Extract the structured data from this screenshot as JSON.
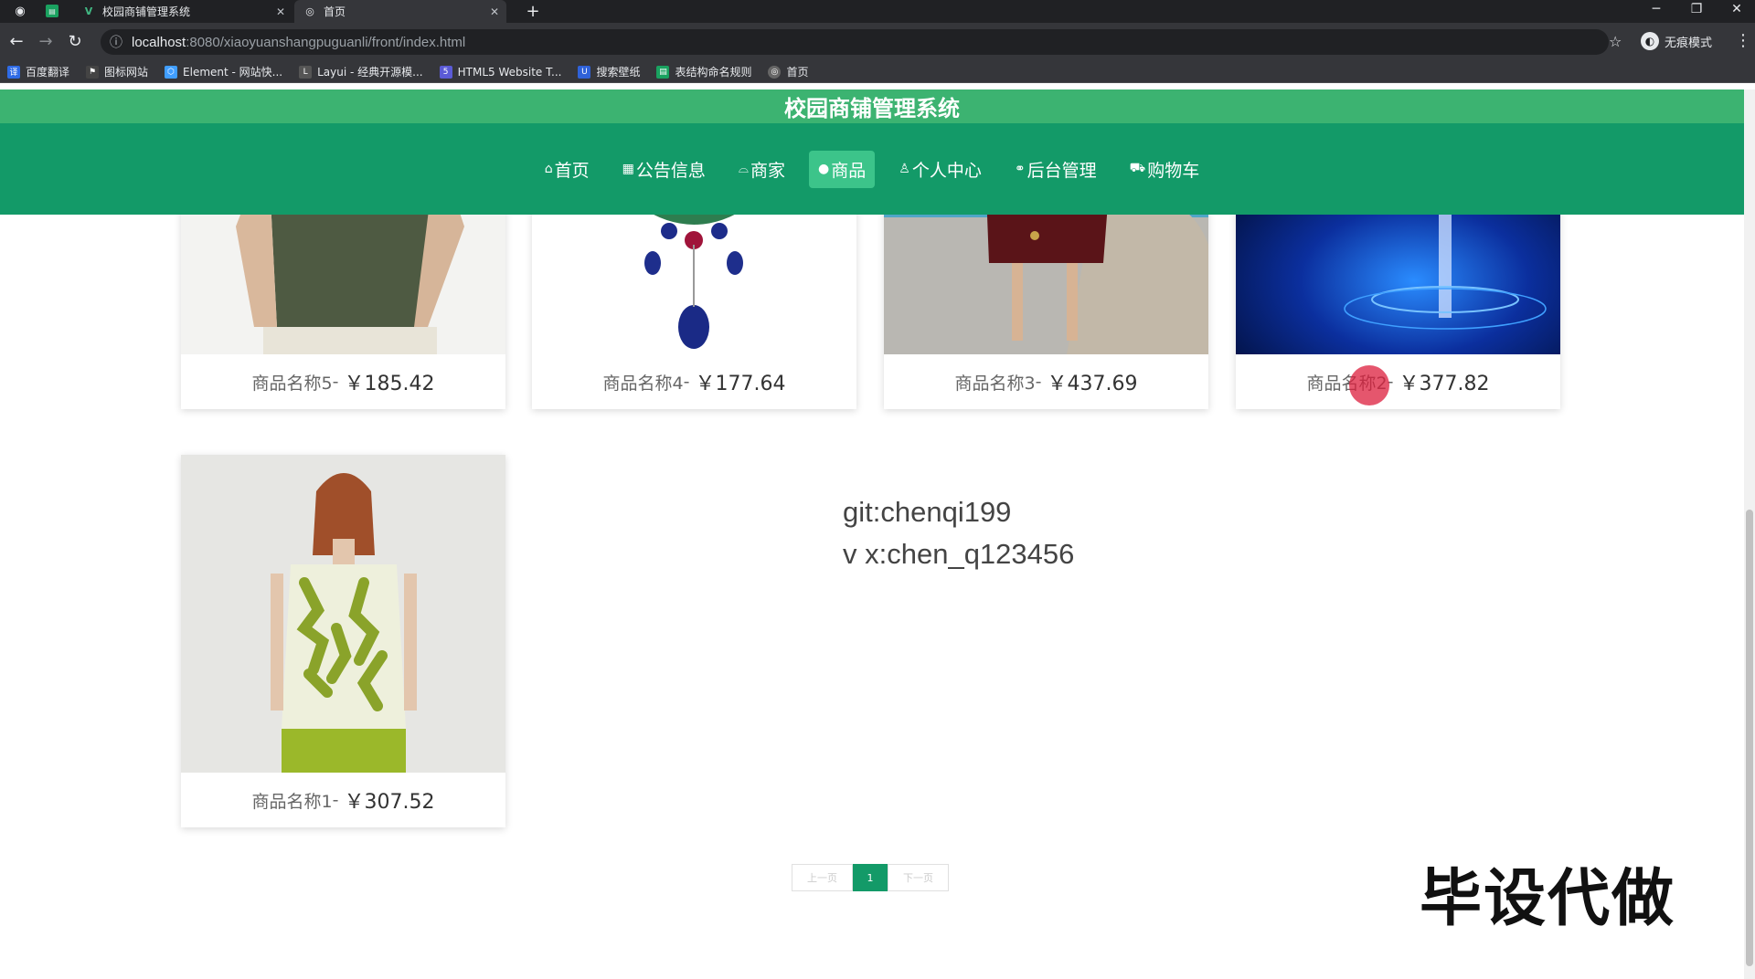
{
  "browser": {
    "tabs": [
      {
        "label": "校园商铺管理系统",
        "active": false
      },
      {
        "label": "首页",
        "active": true
      }
    ],
    "url_host": "localhost",
    "url_path": ":8080/xiaoyuanshangpuguanli/front/index.html",
    "incognito_label": "无痕模式",
    "bookmarks": [
      {
        "label": "百度翻译",
        "icon": "translate-icon",
        "color": "#2e6be6"
      },
      {
        "label": "图标网站",
        "icon": "flag-icon",
        "color": "#444"
      },
      {
        "label": "Element - 网站快...",
        "icon": "element-icon",
        "color": "#409eff"
      },
      {
        "label": "Layui - 经典开源模...",
        "icon": "layui-icon",
        "color": "#555"
      },
      {
        "label": "HTML5 Website T...",
        "icon": "html5-icon",
        "color": "#5b5bd6"
      },
      {
        "label": "搜索壁纸",
        "icon": "wallpaper-icon",
        "color": "#2f62d9"
      },
      {
        "label": "表结构命名规则",
        "icon": "doc-icon",
        "color": "#1aa260"
      },
      {
        "label": "首页",
        "icon": "globe-icon",
        "color": "#666"
      }
    ]
  },
  "site": {
    "title": "校园商铺管理系统",
    "nav": [
      {
        "label": "首页",
        "icon": "home-icon",
        "active": false
      },
      {
        "label": "公告信息",
        "icon": "grid-icon",
        "active": false
      },
      {
        "label": "商家",
        "icon": "shop-icon",
        "active": false
      },
      {
        "label": "商品",
        "icon": "goods-icon",
        "active": true
      },
      {
        "label": "个人中心",
        "icon": "user-icon",
        "active": false
      },
      {
        "label": "后台管理",
        "icon": "link-icon",
        "active": false
      },
      {
        "label": "购物车",
        "icon": "cart-icon",
        "active": false
      }
    ]
  },
  "products": [
    {
      "name": "商品名称5",
      "sep": " - ",
      "price": "￥185.42",
      "image": "green-shirt"
    },
    {
      "name": "商品名称4",
      "sep": " - ",
      "price": "￥177.64",
      "image": "jewel-necklace"
    },
    {
      "name": "商品名称3",
      "sep": " - ",
      "price": "￥437.69",
      "image": "floral-dress-seaside"
    },
    {
      "name": "商品名称2",
      "sep": " - ",
      "price": "￥377.82",
      "image": "blue-tech"
    },
    {
      "name": "商品名称1",
      "sep": " - ",
      "price": "￥307.52",
      "image": "leaf-top"
    }
  ],
  "overlay": {
    "line1": "git:chenqi199",
    "line2": "v x:chen_q123456",
    "stamp": "毕设代做"
  },
  "pagination": {
    "prev": "上一页",
    "current": "1",
    "next": "下一页"
  },
  "colors": {
    "title_bar": "#3cb371",
    "navbar": "#139a68",
    "nav_active": "#3cc48a"
  }
}
